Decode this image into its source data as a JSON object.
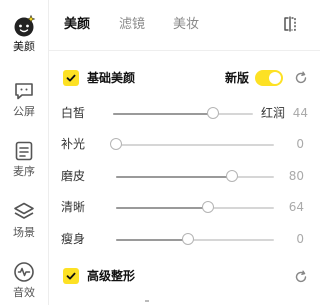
{
  "sidebar": {
    "items": [
      {
        "label": "美颜",
        "icon": "face-beauty-icon",
        "active": true
      },
      {
        "label": "公屏",
        "icon": "chat-bubble-icon",
        "active": false
      },
      {
        "label": "麦序",
        "icon": "list-icon",
        "active": false
      },
      {
        "label": "场景",
        "icon": "layers-icon",
        "active": false
      },
      {
        "label": "音效",
        "icon": "waveform-icon",
        "active": false
      }
    ]
  },
  "tabs": [
    {
      "label": "美颜",
      "active": true
    },
    {
      "label": "滤镜",
      "active": false
    },
    {
      "label": "美妆",
      "active": false
    }
  ],
  "basic": {
    "title": "基础美颜",
    "checked": true,
    "new_version_label": "新版",
    "new_version_on": true,
    "sliders": [
      {
        "label": "白皙",
        "value": "44",
        "right_label": "红润"
      },
      {
        "label": "补光",
        "value": "0"
      },
      {
        "label": "磨皮",
        "value": "80"
      },
      {
        "label": "清晰",
        "value": "64"
      },
      {
        "label": "瘦身",
        "value": "0"
      }
    ]
  },
  "advanced": {
    "title": "高级整形",
    "checked": true
  },
  "colors": {
    "accent": "#fde124",
    "track": "#d6d6d6",
    "fill": "#9a9a9a"
  }
}
